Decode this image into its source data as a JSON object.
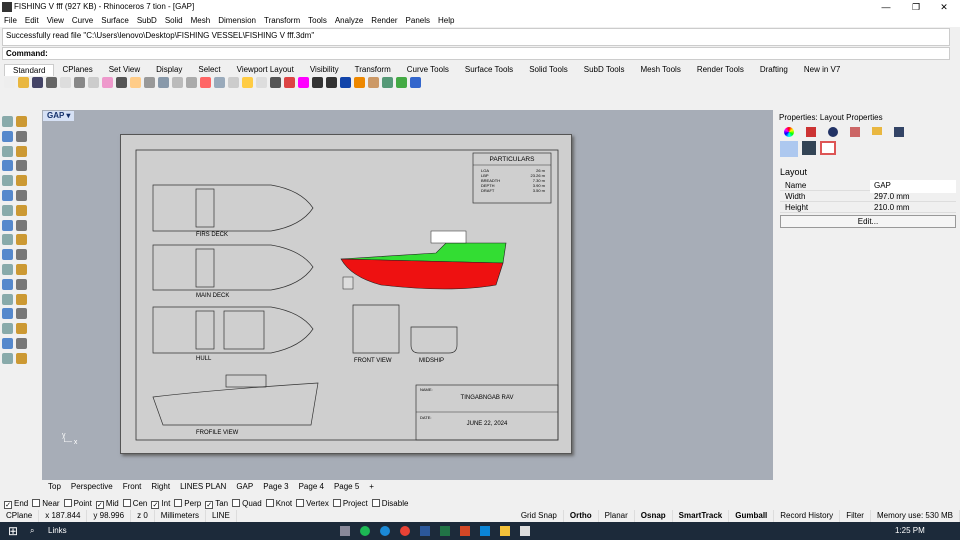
{
  "window": {
    "title": "FISHING V fff (927 KB) - Rhinoceros 7 tion - [GAP]",
    "min": "—",
    "max": "❐",
    "close": "✕"
  },
  "menu": [
    "File",
    "Edit",
    "View",
    "Curve",
    "Surface",
    "SubD",
    "Solid",
    "Mesh",
    "Dimension",
    "Transform",
    "Tools",
    "Analyze",
    "Render",
    "Panels",
    "Help"
  ],
  "history": "Successfully read file \"C:\\Users\\lenovo\\Desktop\\FISHING VESSEL\\FISHING V fff.3dm\"",
  "command_label": "Command:",
  "tabs": [
    "Standard",
    "CPlanes",
    "Set View",
    "Display",
    "Select",
    "Viewport Layout",
    "Visibility",
    "Transform",
    "Curve Tools",
    "Surface Tools",
    "Solid Tools",
    "SubD Tools",
    "Mesh Tools",
    "Render Tools",
    "Drafting",
    "New in V7"
  ],
  "viewport": {
    "name": "GAP",
    "drawing": {
      "particulars_title": "PARTICULARS",
      "particulars": [
        [
          "LOA",
          "26 m"
        ],
        [
          "LBP",
          "23.26 m"
        ],
        [
          "BREADTH",
          "7.30 m"
        ],
        [
          "DEPTH",
          "3.90 m"
        ],
        [
          "DRAFT",
          "3.50 m"
        ]
      ],
      "labels": {
        "first_deck": "FIRS DECK",
        "main_deck": "MAIN DECK",
        "hull": "HULL",
        "profile": "FROFILE VIEW",
        "front": "FRONT VIEW",
        "midship": "MIDSHIP"
      },
      "name_label": "NAME:",
      "name_value": "TINGABNGAB RAV",
      "date_label": "DATE:",
      "date_value": "JUNE 22, 2024"
    },
    "colors": {
      "hull_top": "#33dd33",
      "hull_bottom": "#ee1111"
    }
  },
  "view_tabs": [
    "Top",
    "Perspective",
    "Front",
    "Right",
    "LINES PLAN",
    "GAP",
    "Page 3",
    "Page 4",
    "Page 5",
    "+"
  ],
  "properties": {
    "title": "Properties: Layout Properties",
    "section": "Layout",
    "rows": [
      [
        "Name",
        "GAP"
      ],
      [
        "Width",
        "297.0 mm"
      ],
      [
        "Height",
        "210.0 mm"
      ]
    ],
    "edit": "Edit..."
  },
  "osnap": [
    [
      "End",
      true
    ],
    [
      "Near",
      false
    ],
    [
      "Point",
      false
    ],
    [
      "Mid",
      true
    ],
    [
      "Cen",
      false
    ],
    [
      "Int",
      true
    ],
    [
      "Perp",
      false
    ],
    [
      "Tan",
      true
    ],
    [
      "Quad",
      false
    ],
    [
      "Knot",
      false
    ],
    [
      "Vertex",
      false
    ],
    [
      "Project",
      false
    ],
    [
      "Disable",
      false
    ]
  ],
  "status": [
    "CPlane",
    "x 187.844",
    "y 98.996",
    "z 0",
    "Millimeters",
    "LINE",
    "Grid Snap",
    "Ortho",
    "Planar",
    "Osnap",
    "SmartTrack",
    "Gumball",
    "Record History",
    "Filter",
    "Memory use: 530 MB"
  ],
  "taskbar": {
    "search": "Links",
    "time": "1:25 PM"
  }
}
